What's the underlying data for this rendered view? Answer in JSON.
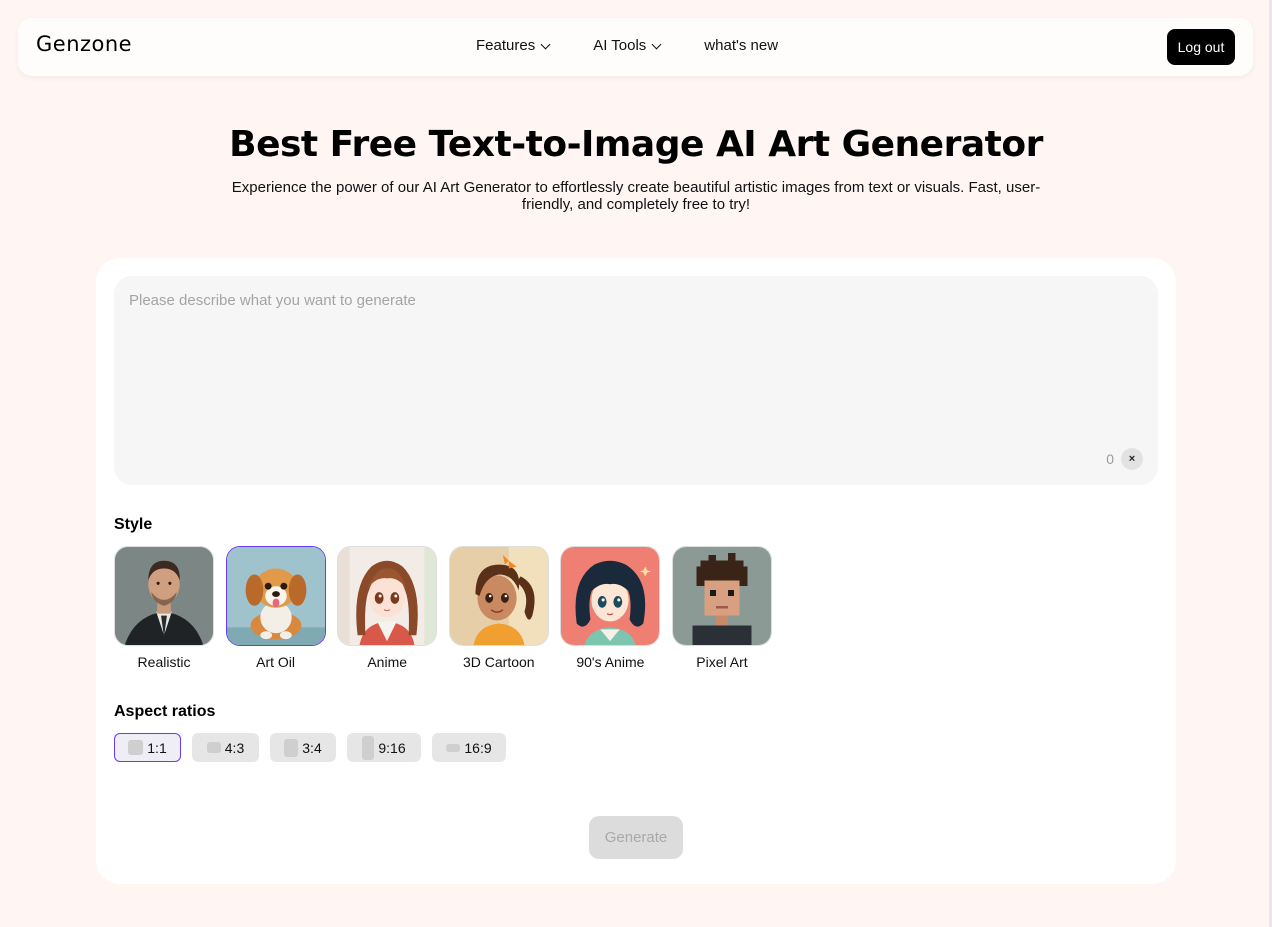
{
  "header": {
    "logo": "Genzone",
    "nav": [
      {
        "label": "Features",
        "dropdown": true
      },
      {
        "label": "AI Tools",
        "dropdown": true
      },
      {
        "label": "what's new",
        "dropdown": false
      }
    ],
    "logout_label": "Log out"
  },
  "hero": {
    "title": "Best Free Text-to-Image AI Art Generator",
    "subtitle": "Experience the power of our AI Art Generator to effortlessly create beautiful artistic images from text or visuals. Fast, user-friendly, and completely free to try!"
  },
  "prompt": {
    "placeholder": "Please describe what you want to generate",
    "value": "",
    "char_count": "0",
    "clear_icon": "close-icon",
    "clear_label": "×"
  },
  "style": {
    "label": "Style",
    "selected": "Art Oil",
    "items": [
      {
        "label": "Realistic",
        "image": "portrait-man-suit"
      },
      {
        "label": "Art Oil",
        "image": "puppy-painting"
      },
      {
        "label": "Anime",
        "image": "anime-girl"
      },
      {
        "label": "3D Cartoon",
        "image": "cartoon-girl"
      },
      {
        "label": "90's Anime",
        "image": "retro-anime-girl"
      },
      {
        "label": "Pixel Art",
        "image": "pixel-boy"
      }
    ]
  },
  "aspect": {
    "label": "Aspect ratios",
    "selected": "1:1",
    "items": [
      {
        "label": "1:1"
      },
      {
        "label": "4:3"
      },
      {
        "label": "3:4"
      },
      {
        "label": "9:16"
      },
      {
        "label": "16:9"
      }
    ]
  },
  "generate_label": "Generate",
  "colors": {
    "page_bg": "#fff5f3",
    "accent": "#6a3cf0",
    "button_dark": "#000000",
    "disabled": "#dcdcdc"
  }
}
